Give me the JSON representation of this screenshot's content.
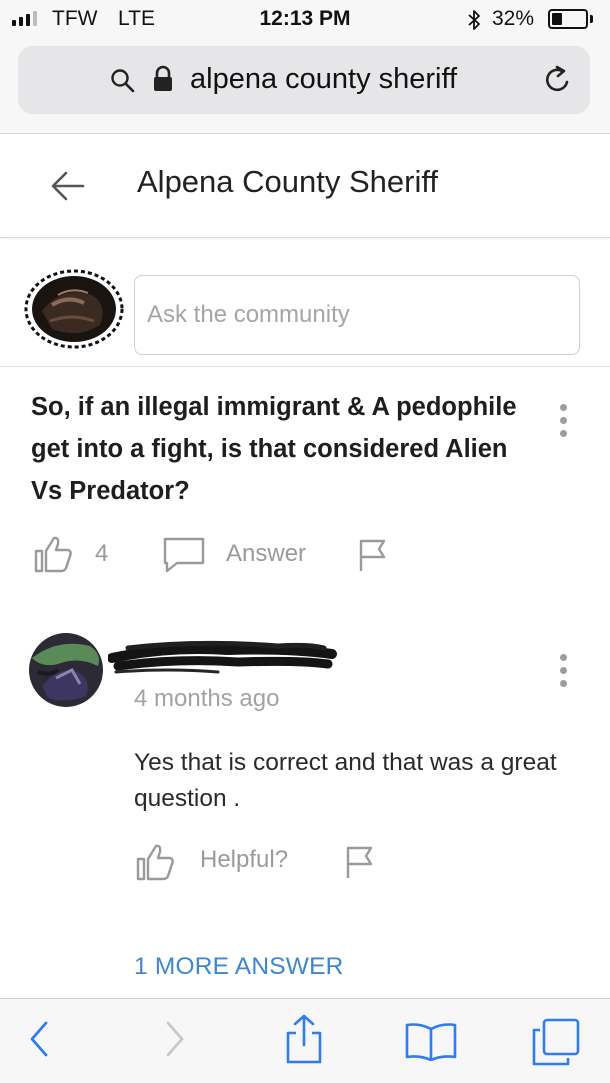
{
  "status_bar": {
    "carrier": "TFW",
    "network": "LTE",
    "time": "12:13 PM",
    "battery_percent": "32%",
    "battery_level": 0.32,
    "signal_bars_active": 3,
    "signal_bars_total": 4
  },
  "browser": {
    "url": "alpena county sheriff"
  },
  "header": {
    "title": "Alpena County Sheriff"
  },
  "ask": {
    "placeholder": "Ask the community"
  },
  "question": {
    "text": "So, if an illegal immigrant & A pedophile get into a fight, is that considered Alien Vs Predator?",
    "like_count": "4",
    "answer_label": "Answer"
  },
  "answer": {
    "time_ago": "4 months ago",
    "text": "Yes that is correct and that was a great question .",
    "helpful_label": "Helpful?"
  },
  "more_answers_label": "1 MORE ANSWER",
  "colors": {
    "link_blue": "#3f86d0",
    "icon_gray": "#9a9a9a",
    "safari_blue": "#2f7bf2"
  },
  "icons": [
    "signal-icon",
    "bluetooth-icon",
    "battery-icon",
    "search-icon",
    "lock-icon",
    "reload-icon",
    "back-arrow-icon",
    "more-icon",
    "like-icon",
    "answer-icon",
    "flag-icon",
    "share-icon",
    "bookmarks-icon",
    "tabs-icon"
  ]
}
